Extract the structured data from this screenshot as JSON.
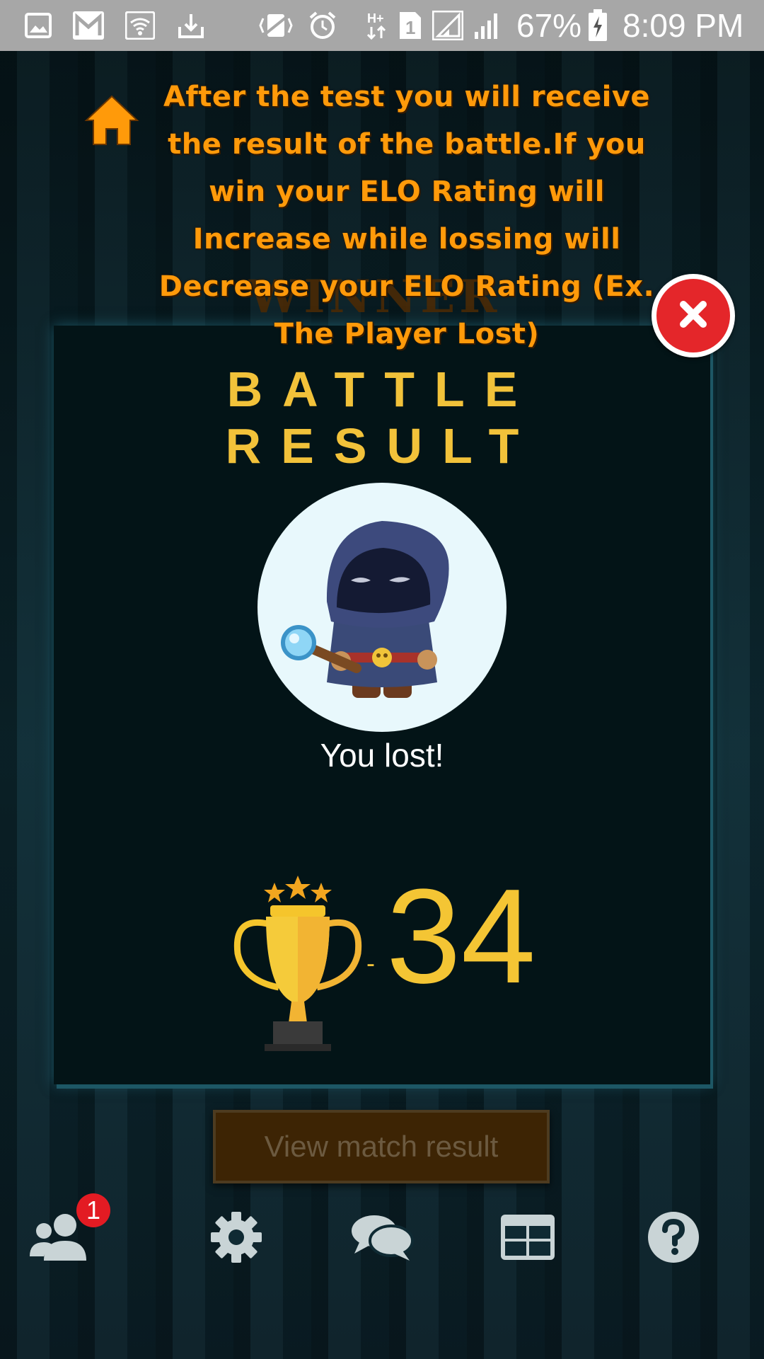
{
  "status_bar": {
    "icons": [
      "gallery-icon",
      "gmail-icon",
      "wifi-icon",
      "download-icon",
      "vibrate-icon",
      "alarm-icon",
      "hplus-data-icon",
      "sim1-icon",
      "signal-icon",
      "signal-2-icon",
      "battery-charging-icon"
    ],
    "battery": "67%",
    "time": "8:09 PM"
  },
  "overlay": {
    "instruction": "After the test you will receive the result of the battle.If you win your ELO Rating will Increase while lossing will Decrease your ELO Rating (Ex. The Player Lost)",
    "accent_color": "#ff9a0a"
  },
  "background": {
    "banner_text": "WINNER"
  },
  "result_card": {
    "title": "BATTLE RESULT",
    "avatar": "hooded-mage-avatar",
    "result_text": "You lost!",
    "score_sign": "-",
    "score": "34",
    "title_color": "#f2c23a"
  },
  "actions": {
    "view_match_result": "View match result"
  },
  "bottom_nav": {
    "items": [
      "friends-icon",
      "settings-icon",
      "chat-icon",
      "leaderboard-icon",
      "help-icon"
    ],
    "friends_badge": "1"
  }
}
